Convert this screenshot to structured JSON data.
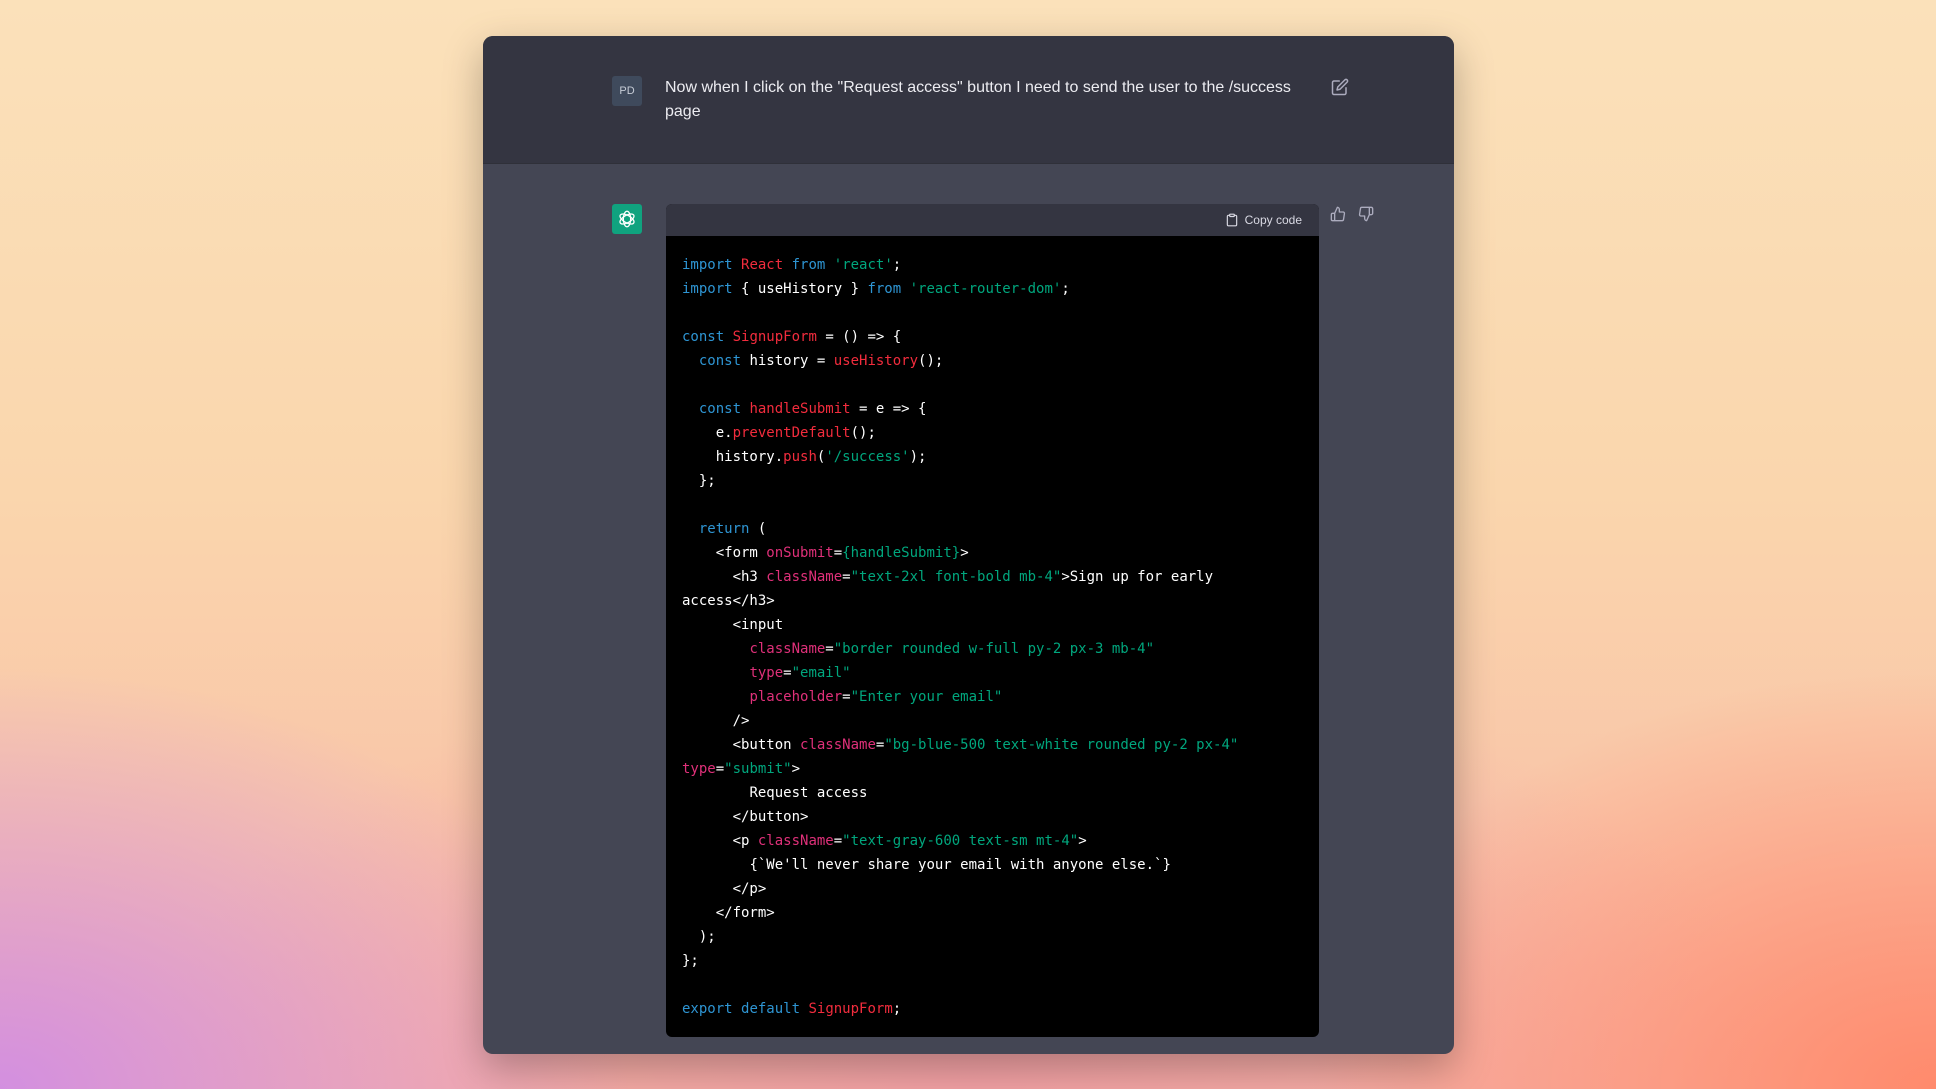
{
  "user": {
    "avatar_initials": "PD",
    "message": "Now when I click on the \"Request access\" button I need to send the user to the /success page"
  },
  "code_block": {
    "copy_label": "Copy code"
  },
  "code": {
    "l1_a": "import",
    "l1_b": "React",
    "l1_c": "from",
    "l1_d": "'react'",
    "l1_e": ";",
    "l2_a": "import",
    "l2_b": " { useHistory } ",
    "l2_c": "from",
    "l2_d": "'react-router-dom'",
    "l2_e": ";",
    "l4_a": "const",
    "l4_b": "SignupForm",
    "l4_c": " = () => {",
    "l5_a": "const",
    "l5_b": " history = ",
    "l5_c": "useHistory",
    "l5_d": "();",
    "l7_a": "const",
    "l7_b": "handleSubmit",
    "l7_c": " = e => {",
    "l8_a": "e.",
    "l8_b": "preventDefault",
    "l8_c": "();",
    "l9_a": "history.",
    "l9_b": "push",
    "l9_c": "(",
    "l9_d": "'/success'",
    "l9_e": ");",
    "l10": "};",
    "l12_a": "return",
    "l12_b": " (",
    "l13_a": "<form ",
    "l13_b": "onSubmit",
    "l13_c": "=",
    "l13_d": "{handleSubmit}",
    "l13_e": ">",
    "l14_a": "<h3 ",
    "l14_b": "className",
    "l14_c": "=",
    "l14_d": "\"text-2xl font-bold mb-4\"",
    "l14_e": ">Sign up for early",
    "l15": "access</h3>",
    "l16": "<input",
    "l17_a": "className",
    "l17_b": "=",
    "l17_c": "\"border rounded w-full py-2 px-3 mb-4\"",
    "l18_a": "type",
    "l18_b": "=",
    "l18_c": "\"email\"",
    "l19_a": "placeholder",
    "l19_b": "=",
    "l19_c": "\"Enter your email\"",
    "l20": "/>",
    "l21_a": "<button ",
    "l21_b": "className",
    "l21_c": "=",
    "l21_d": "\"bg-blue-500 text-white rounded py-2 px-4\"",
    "l22_a": "type",
    "l22_b": "=",
    "l22_c": "\"submit\"",
    "l22_d": ">",
    "l23": "Request access",
    "l24": "</button>",
    "l25_a": "<p ",
    "l25_b": "className",
    "l25_c": "=",
    "l25_d": "\"text-gray-600 text-sm mt-4\"",
    "l25_e": ">",
    "l26": "{`We'll never share your email with anyone else.`}",
    "l27": "</p>",
    "l28": "</form>",
    "l29": ");",
    "l30": "};",
    "l32_a": "export",
    "l32_b": "default",
    "l32_c": "SignupForm",
    "l32_d": ";"
  }
}
